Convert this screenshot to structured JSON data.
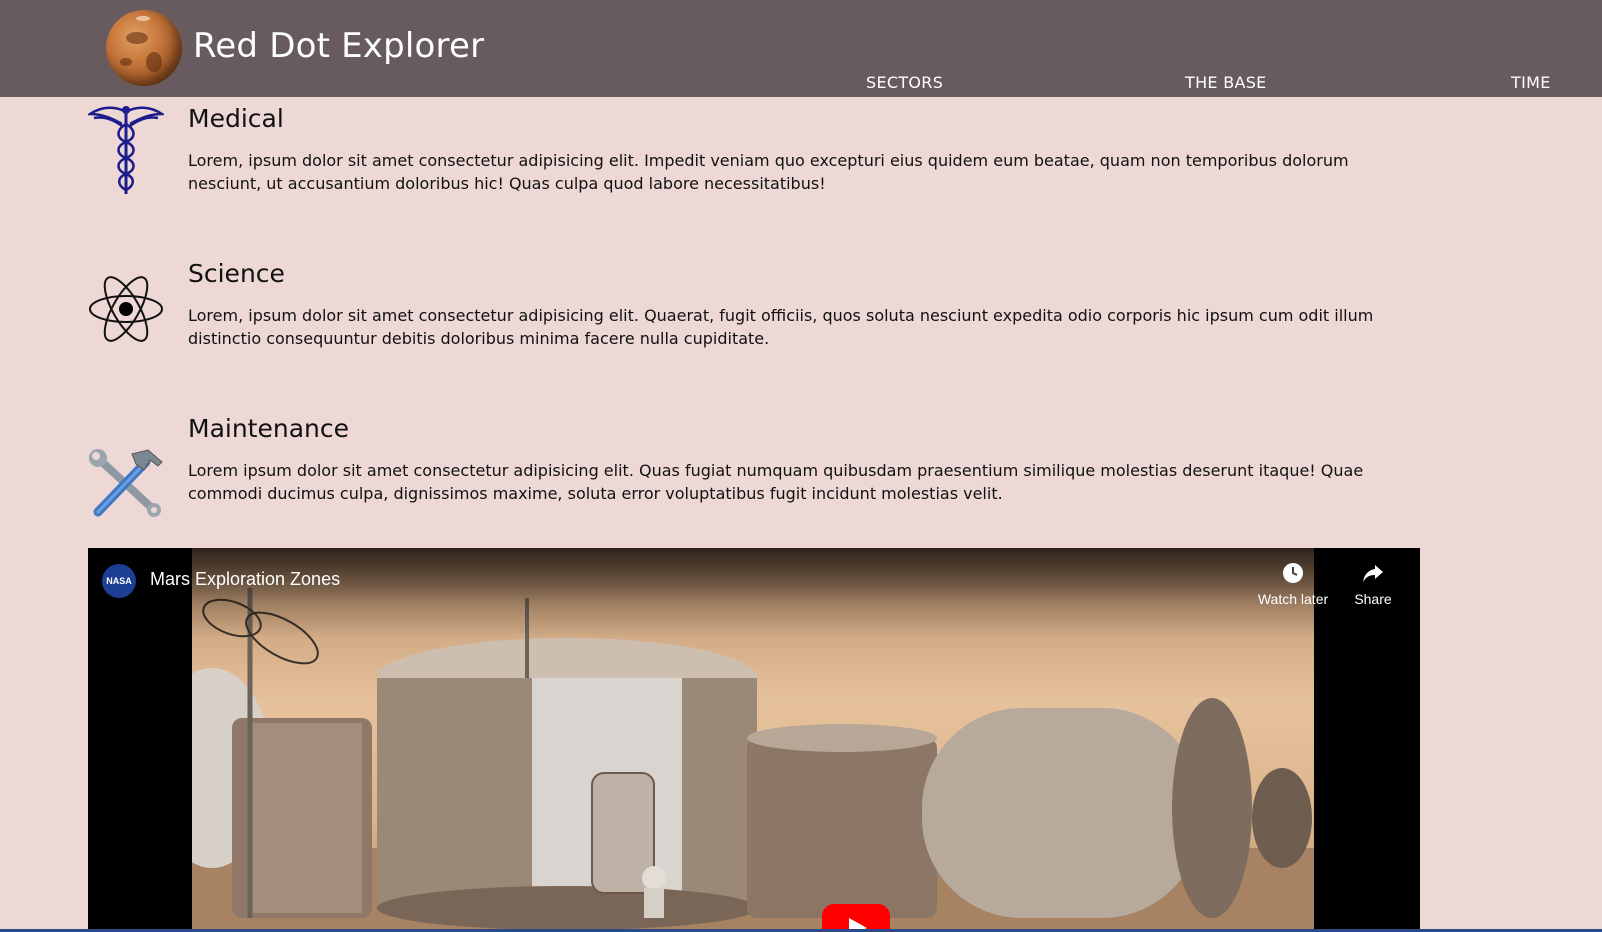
{
  "header": {
    "brand": "Red Dot Explorer",
    "logo_icon": "mars-planet-icon",
    "nav": [
      {
        "label": "SECTORS"
      },
      {
        "label": "THE BASE"
      },
      {
        "label": "TIME"
      }
    ],
    "bg_color": "#675b5f"
  },
  "sectors": [
    {
      "title": "Medical",
      "icon": "caduceus-icon",
      "text": "Lorem, ipsum dolor sit amet consectetur adipisicing elit. Impedit veniam quo excepturi eius quidem eum beatae, quam non temporibus dolorum nesciunt, ut accusantium doloribus hic! Quas culpa quod labore necessitatibus!"
    },
    {
      "title": "Science",
      "icon": "atom-icon",
      "text": "Lorem, ipsum dolor sit amet consectetur adipisicing elit. Quaerat, fugit officiis, quos soluta nesciunt expedita odio corporis hic ipsum cum odit illum distinctio consequuntur debitis doloribus minima facere nulla cupiditate."
    },
    {
      "title": "Maintenance",
      "icon": "wrench-hammer-icon",
      "text": "Lorem ipsum dolor sit amet consectetur adipisicing elit. Quas fugiat numquam quibusdam praesentium similique molestias deserunt itaque! Quae commodi ducimus culpa, dignissimos maxime, soluta error voluptatibus fugit incidunt molestias velit."
    }
  ],
  "video": {
    "channel_logo": "NASA",
    "title": "Mars Exploration Zones",
    "watch_later": "Watch later",
    "share": "Share"
  },
  "colors": {
    "page_bg": "#eed8d6",
    "play_button": "#ff0000"
  }
}
